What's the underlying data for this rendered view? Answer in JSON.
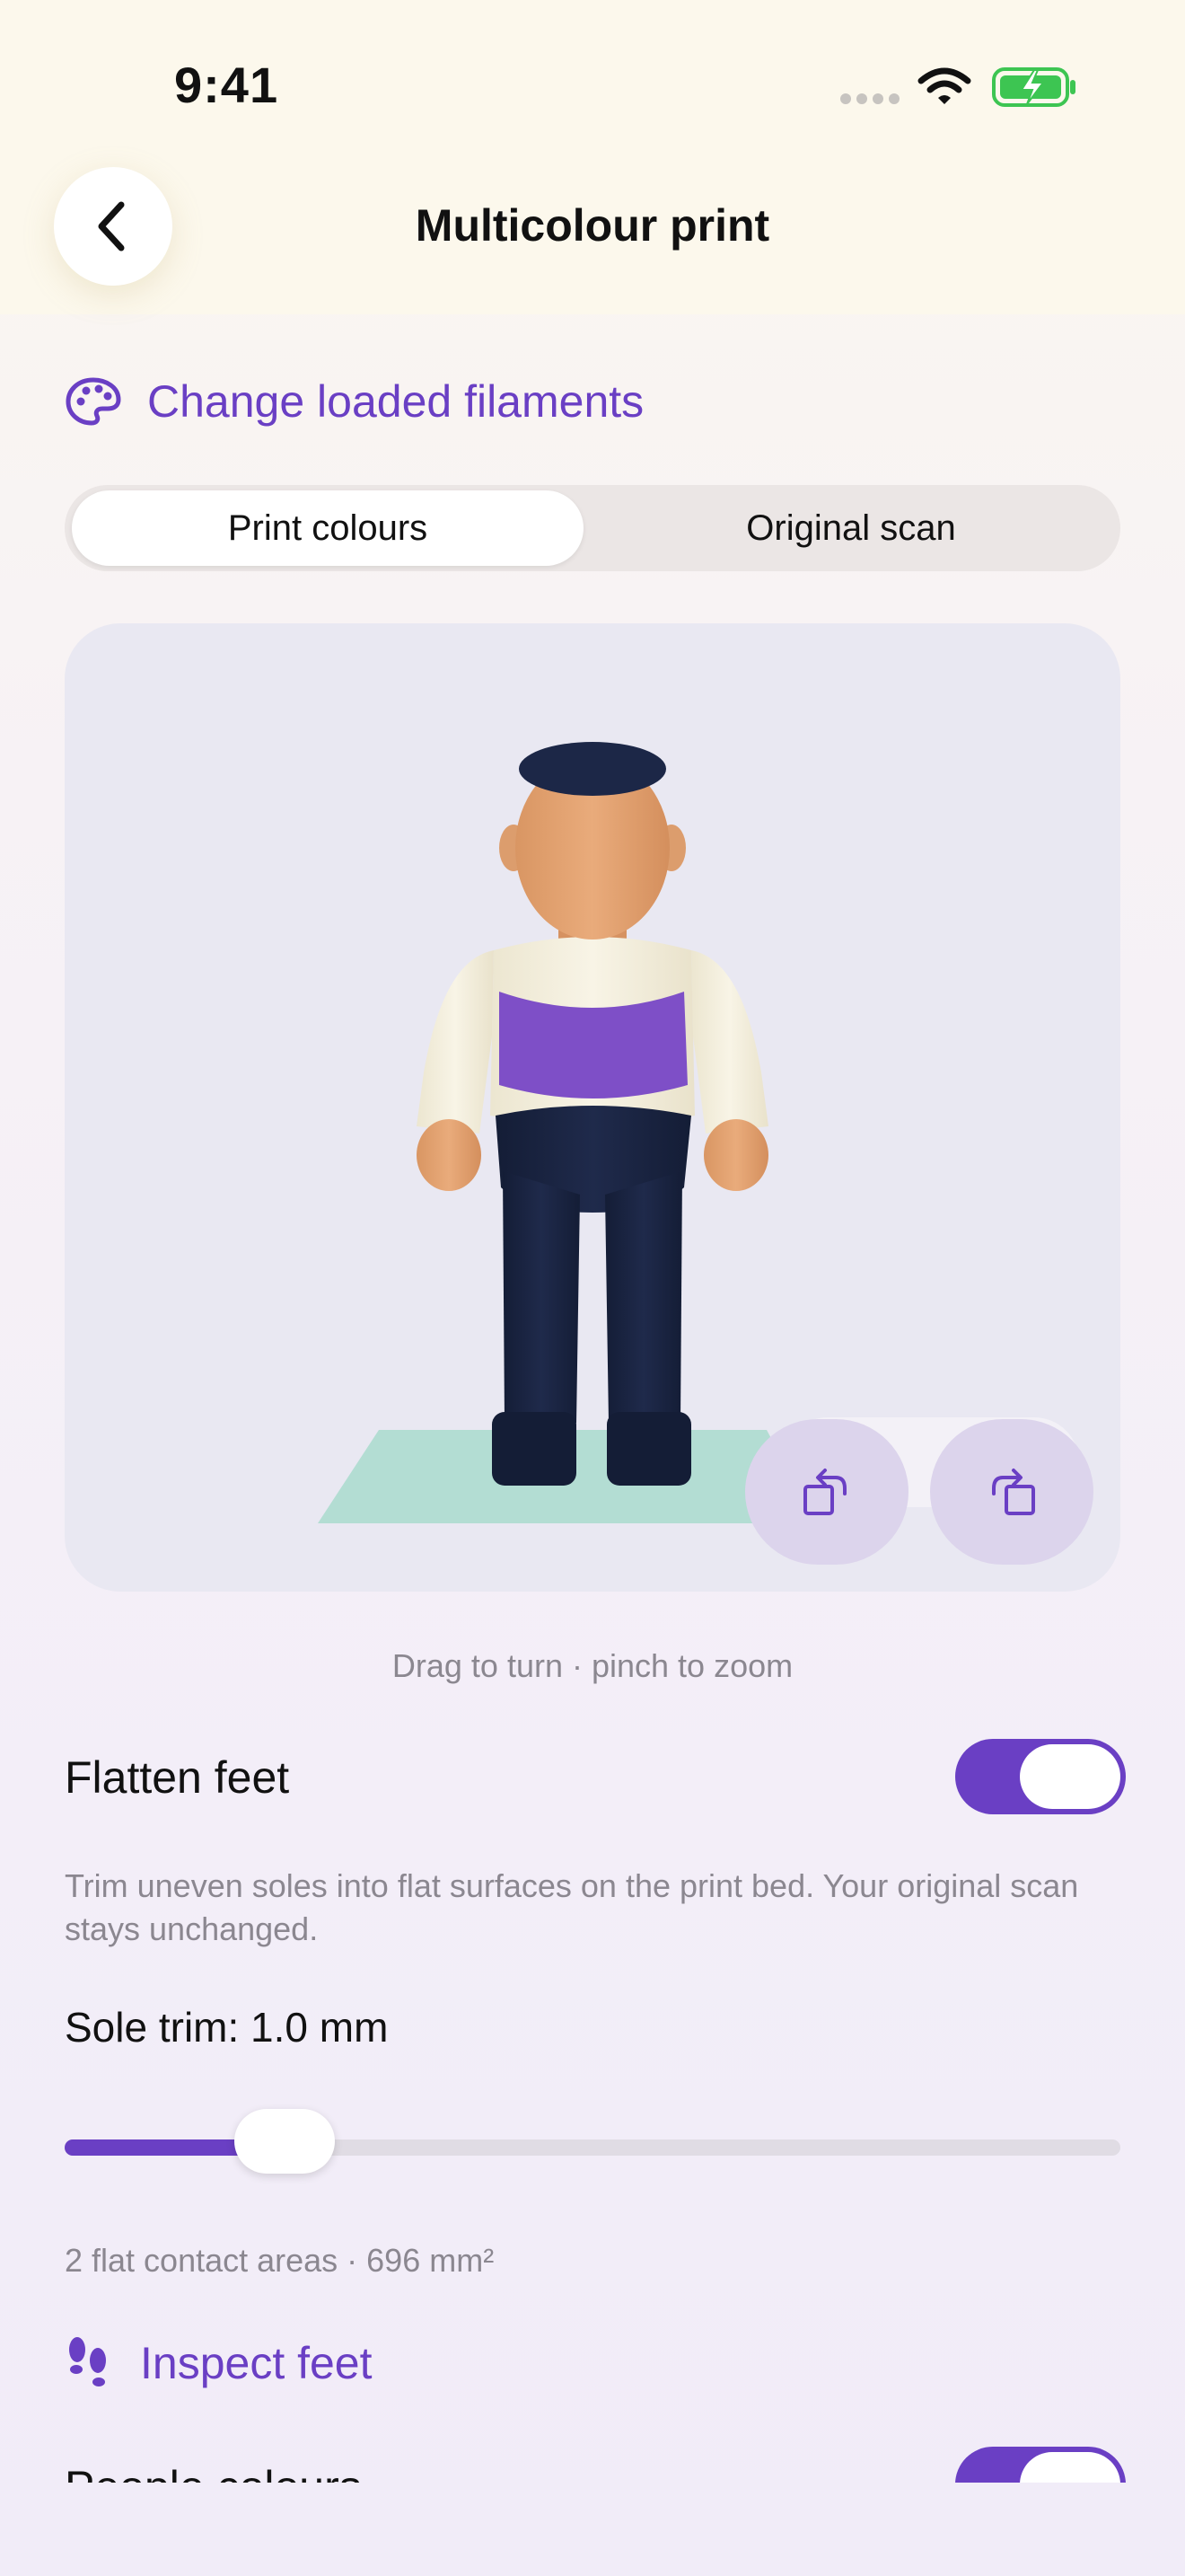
{
  "status_bar": {
    "time": "9:41"
  },
  "header": {
    "title": "Multicolour print",
    "back_icon": "chevron-left-icon"
  },
  "filaments": {
    "label": "Change loaded filaments",
    "icon": "palette-icon"
  },
  "segmented": {
    "options": [
      "Print colours",
      "Original scan"
    ],
    "selected": "Print colours"
  },
  "viewer": {
    "hint": "Drag to turn · pinch to zoom",
    "buttons": [
      "rotate-left-icon",
      "rotate-right-icon"
    ],
    "model_colors": {
      "skin": "#e8a877",
      "cap": "#1c2747",
      "top": "#f5f1e2",
      "chest": "#7e4fc7",
      "trousers": "#1c2747",
      "bed": "#b3ddd3"
    }
  },
  "flatten_feet": {
    "label": "Flatten feet",
    "enabled": true,
    "description": "Trim uneven soles into flat surfaces on the print bed. Your original scan stays unchanged."
  },
  "sole_trim": {
    "label": "Sole trim: 1.0 mm",
    "slider_fraction": 0.2
  },
  "contact_info": "2 flat contact areas · 696 mm²",
  "inspect": {
    "label": "Inspect feet",
    "icon": "footprints-icon"
  },
  "people_colours": {
    "label": "People colours",
    "enabled": true
  },
  "colors": {
    "accent": "#6a3fc4",
    "muted_text": "#8b8790"
  }
}
